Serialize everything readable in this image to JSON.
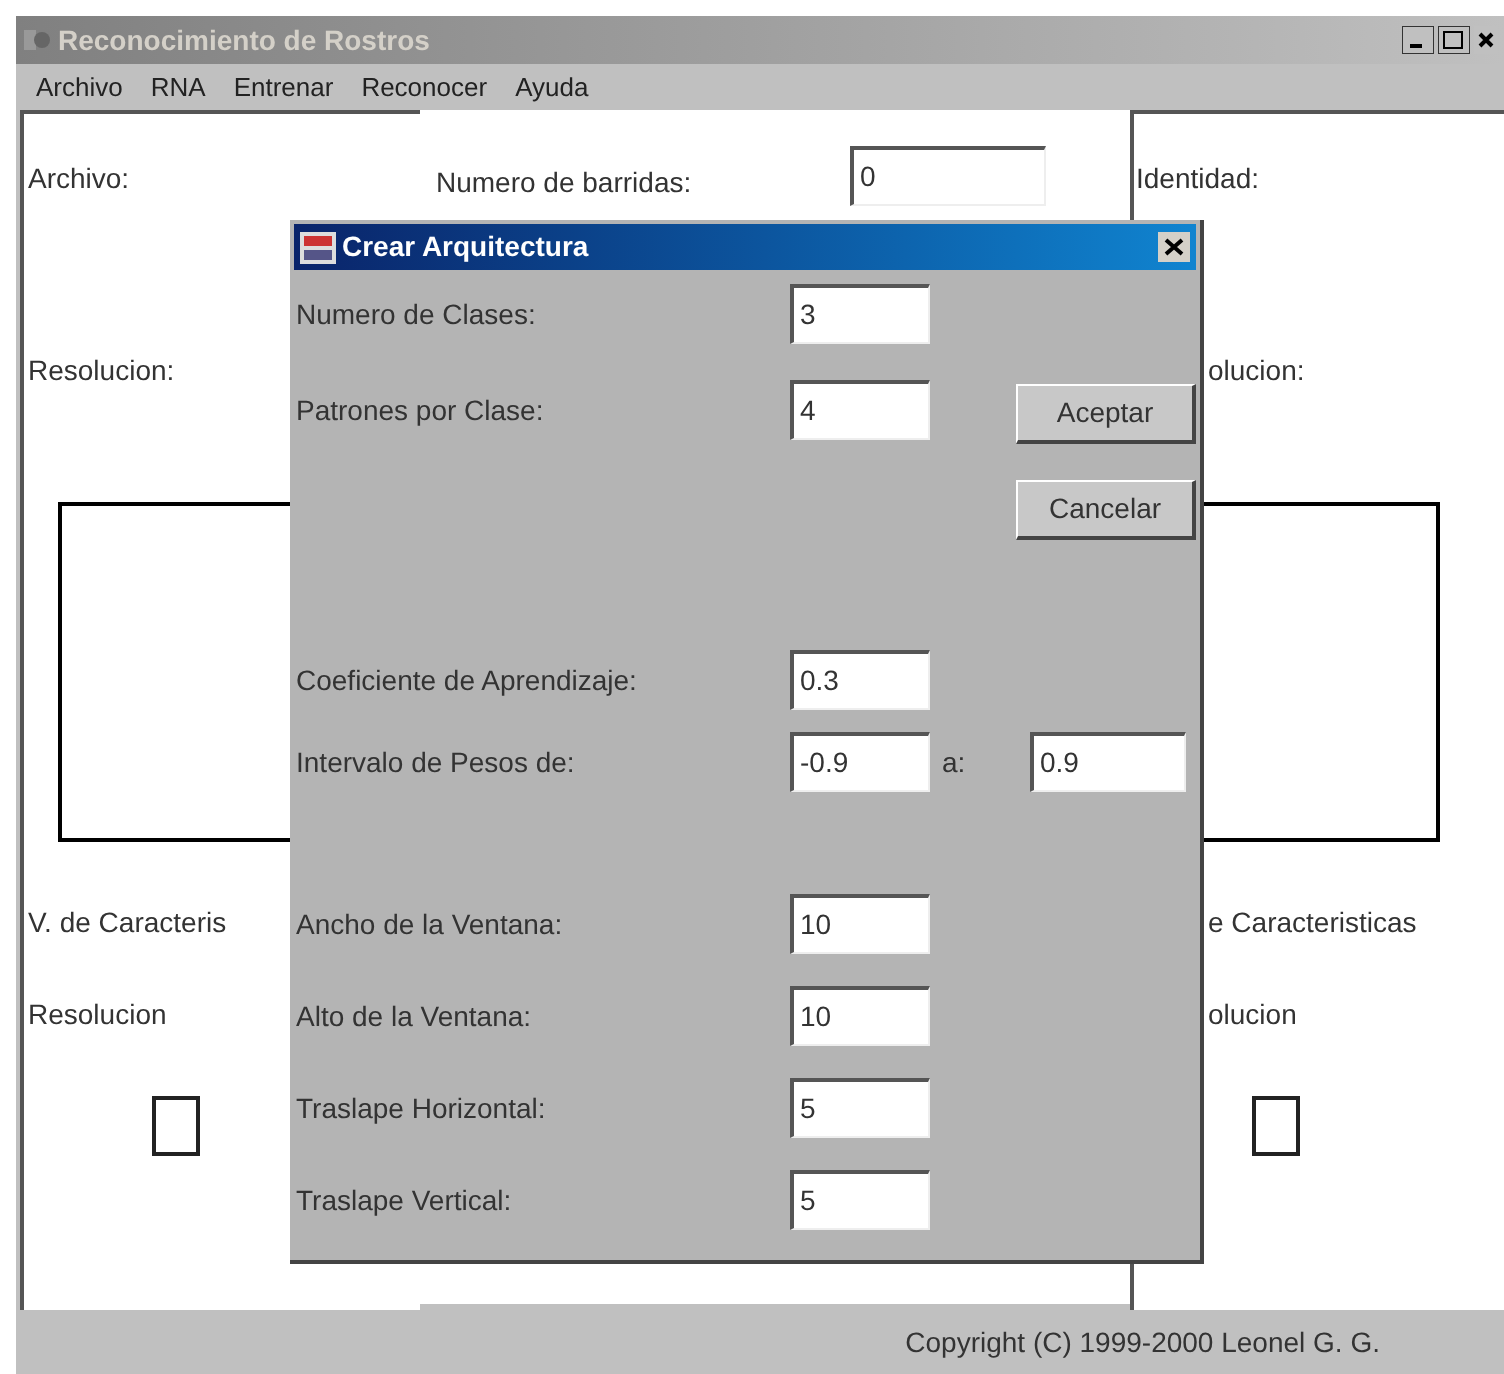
{
  "window": {
    "title": "Reconocimiento de Rostros",
    "active": false
  },
  "menu": [
    {
      "label": "Archivo"
    },
    {
      "label": "RNA"
    },
    {
      "label": "Entrenar"
    },
    {
      "label": "Reconocer"
    },
    {
      "label": "Ayuda"
    }
  ],
  "left_panel": {
    "file_label": "Archivo:",
    "resolution_label": "Resolucion:",
    "features_label": "V. de Caracteris",
    "resolution_label_2": "Resolucion"
  },
  "center_panel": {
    "sweeps_label": "Numero de barridas:",
    "sweeps_value": "0"
  },
  "right_panel": {
    "identity_label": "Identidad:",
    "resolution_label": "olucion:",
    "features_label": "e Caracteristicas",
    "resolution_label_2": "olucion"
  },
  "dialog": {
    "title": "Crear Arquitectura",
    "sections": [
      [
        {
          "kind": "single",
          "label": "Numero de Clases:",
          "value": "3"
        },
        {
          "kind": "single",
          "label": "Patrones por Clase:",
          "value": "4"
        }
      ],
      [
        {
          "kind": "single",
          "label": "Coeficiente de Aprendizaje:",
          "value": "0.3"
        },
        {
          "kind": "range",
          "label": "Intervalo de Pesos de:",
          "value": "-0.9",
          "to_label": "a:",
          "to_value": "0.9"
        }
      ],
      [
        {
          "kind": "single",
          "label": "Ancho de la Ventana:",
          "value": "10"
        },
        {
          "kind": "single",
          "label": "Alto de la Ventana:",
          "value": "10"
        },
        {
          "kind": "single",
          "label": "Traslape Horizontal:",
          "value": "5"
        },
        {
          "kind": "single",
          "label": "Traslape Vertical:",
          "value": "5"
        }
      ]
    ],
    "buttons": [
      "Aceptar",
      "Cancelar"
    ]
  },
  "status_bar": {
    "text": "Copyright (C) 1999-2000 Leonel G. G."
  }
}
